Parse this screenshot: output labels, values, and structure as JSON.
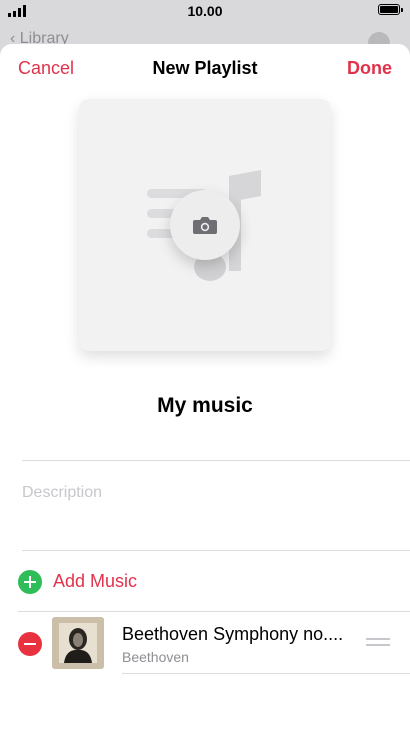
{
  "status_bar": {
    "time": "10.00"
  },
  "background": {
    "back_label": "Library"
  },
  "nav": {
    "cancel": "Cancel",
    "title": "New Playlist",
    "done": "Done"
  },
  "playlist": {
    "name": "My music",
    "description_placeholder": "Description",
    "description_value": ""
  },
  "add_music": {
    "label": "Add Music"
  },
  "songs": [
    {
      "title": "Beethoven Symphony no....",
      "artist": "Beethoven"
    }
  ],
  "colors": {
    "accent": "#e0334b",
    "add": "#2ebd58",
    "remove": "#e8323f"
  }
}
